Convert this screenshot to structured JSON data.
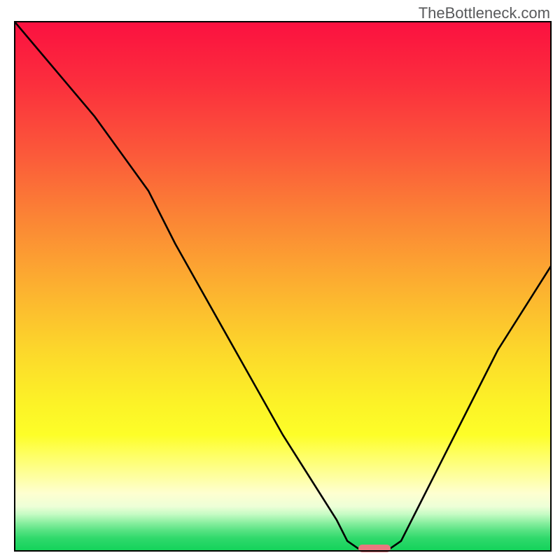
{
  "watermark": {
    "text": "TheBottleneck.com"
  },
  "chart_data": {
    "type": "line",
    "title": "",
    "xlabel": "",
    "ylabel": "",
    "xlim": [
      0,
      100
    ],
    "ylim": [
      0,
      100
    ],
    "grid": false,
    "legend": false,
    "annotations": [],
    "series": [
      {
        "name": "bottleneck-curve",
        "color": "#000000",
        "x": [
          0,
          5,
          10,
          15,
          20,
          25,
          30,
          35,
          40,
          45,
          50,
          55,
          60,
          62,
          64,
          66,
          68,
          70,
          72,
          75,
          80,
          85,
          90,
          95,
          100
        ],
        "y": [
          100,
          94,
          88,
          82,
          75,
          68,
          58,
          49,
          40,
          31,
          22,
          14,
          6,
          2,
          0.6,
          0.6,
          0.6,
          0.6,
          2,
          8,
          18,
          28,
          38,
          46,
          54
        ]
      }
    ],
    "marker": {
      "name": "target-band",
      "color": "#e9787f",
      "x_start": 64,
      "x_end": 70,
      "y": 0.6,
      "thickness_pct": 1.4
    },
    "background_gradient": {
      "stops": [
        {
          "pos": 0,
          "color": "#fb1040"
        },
        {
          "pos": 12,
          "color": "#fb2f3d"
        },
        {
          "pos": 25,
          "color": "#fb593a"
        },
        {
          "pos": 37,
          "color": "#fb8435"
        },
        {
          "pos": 50,
          "color": "#fcb030"
        },
        {
          "pos": 62,
          "color": "#fcd72b"
        },
        {
          "pos": 72,
          "color": "#fcf227"
        },
        {
          "pos": 78,
          "color": "#fdfe28"
        },
        {
          "pos": 82,
          "color": "#feff67"
        },
        {
          "pos": 86,
          "color": "#feffa2"
        },
        {
          "pos": 89,
          "color": "#feffd0"
        },
        {
          "pos": 91.5,
          "color": "#edffd7"
        },
        {
          "pos": 93,
          "color": "#c4fbc3"
        },
        {
          "pos": 94.5,
          "color": "#8cefa1"
        },
        {
          "pos": 96,
          "color": "#58e383"
        },
        {
          "pos": 97.5,
          "color": "#2fd96b"
        },
        {
          "pos": 100,
          "color": "#11d259"
        }
      ]
    }
  }
}
